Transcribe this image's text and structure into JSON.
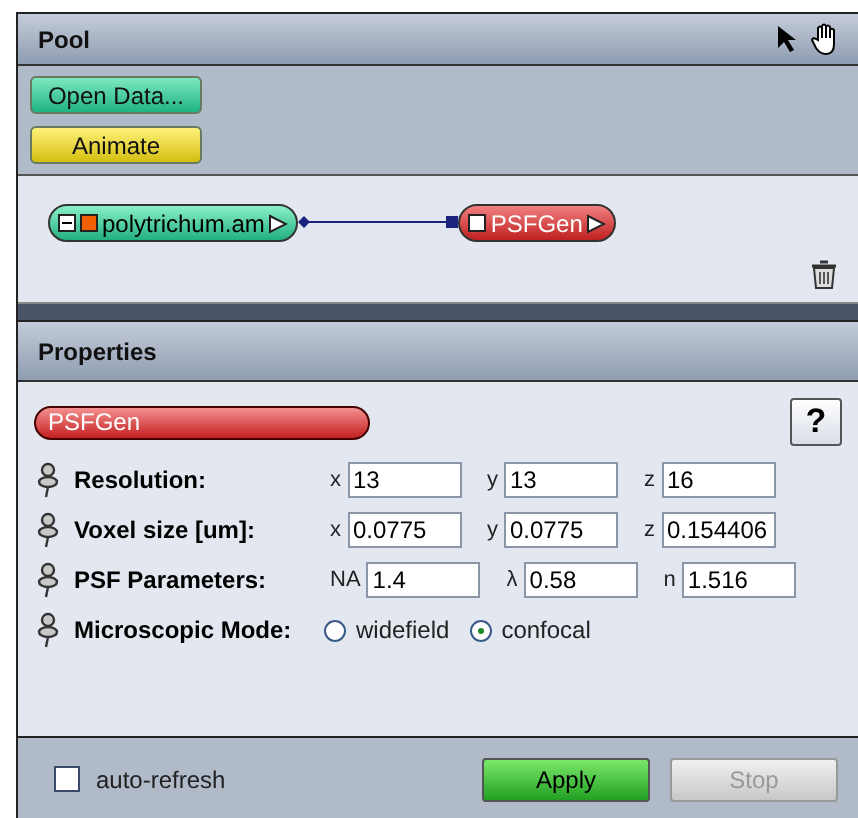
{
  "pool": {
    "title": "Pool",
    "buttons": [
      {
        "label": "Open Data...",
        "kind": "data"
      },
      {
        "label": "Animate",
        "kind": "animate"
      }
    ],
    "nodes": [
      {
        "label": "polytrichum.am",
        "kind": "data"
      },
      {
        "label": "PSFGen",
        "kind": "module"
      }
    ]
  },
  "properties": {
    "title": "Properties",
    "module_label": "PSFGen",
    "help": "?",
    "rows": [
      {
        "kind": "fields",
        "label": "Resolution:",
        "fields": [
          {
            "prefix": "x",
            "value": "13"
          },
          {
            "prefix": "y",
            "value": "13"
          },
          {
            "prefix": "z",
            "value": "16"
          }
        ]
      },
      {
        "kind": "fields",
        "label": "Voxel size [um]:",
        "fields": [
          {
            "prefix": "x",
            "value": "0.0775"
          },
          {
            "prefix": "y",
            "value": "0.0775"
          },
          {
            "prefix": "z",
            "value": "0.154406"
          }
        ]
      },
      {
        "kind": "fields",
        "label": "PSF Parameters:",
        "fields": [
          {
            "prefix": "NA",
            "value": "1.4"
          },
          {
            "prefix": "λ",
            "value": "0.58"
          },
          {
            "prefix": "n",
            "value": "1.516"
          }
        ]
      },
      {
        "kind": "radio",
        "label": "Microscopic Mode:",
        "options": [
          {
            "label": "widefield",
            "selected": false
          },
          {
            "label": "confocal",
            "selected": true
          }
        ]
      }
    ]
  },
  "footer": {
    "auto_refresh": {
      "label": "auto-refresh",
      "checked": false
    },
    "buttons": [
      {
        "label": "Apply",
        "disabled": false
      },
      {
        "label": "Stop",
        "disabled": true
      }
    ]
  }
}
